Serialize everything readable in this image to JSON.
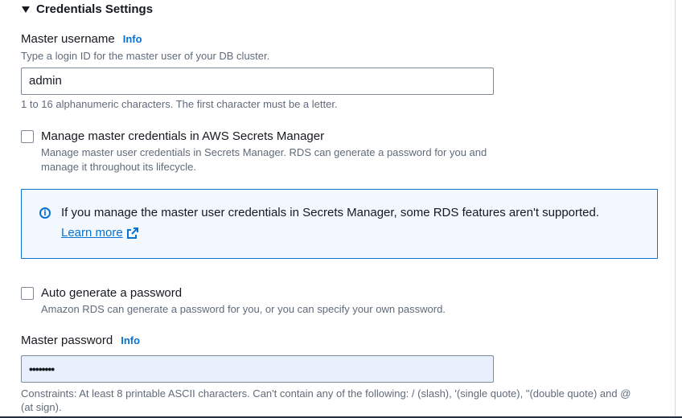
{
  "section": {
    "title": "Credentials Settings"
  },
  "username": {
    "label": "Master username",
    "info": "Info",
    "description": "Type a login ID for the master user of your DB cluster.",
    "value": "admin",
    "constraint": "1 to 16 alphanumeric characters. The first character must be a letter."
  },
  "secrets_manager": {
    "label": "Manage master credentials in AWS Secrets Manager",
    "description_line1": "Manage master user credentials in Secrets Manager. RDS can generate a password for you and",
    "description_line2": "manage it throughout its lifecycle.",
    "checked": false
  },
  "alert": {
    "icon": "info-circle-icon",
    "text": "If you manage the master user credentials in Secrets Manager, some RDS features aren't supported.",
    "link": "Learn more"
  },
  "auto_password": {
    "label": "Auto generate a password",
    "description": "Amazon RDS can generate a password for you, or you can specify your own password.",
    "checked": false
  },
  "password": {
    "label": "Master password",
    "info": "Info",
    "masked_value": "••••••••",
    "constraint_line1": "Constraints: At least 8 printable ASCII characters. Can't contain any of the following: / (slash), '(single quote), \"(double quote) and @",
    "constraint_line2": "(at sign)."
  },
  "colors": {
    "link": "#0972d3",
    "alert_bg": "#f2f8fd",
    "autofill_bg": "#e8effd"
  }
}
